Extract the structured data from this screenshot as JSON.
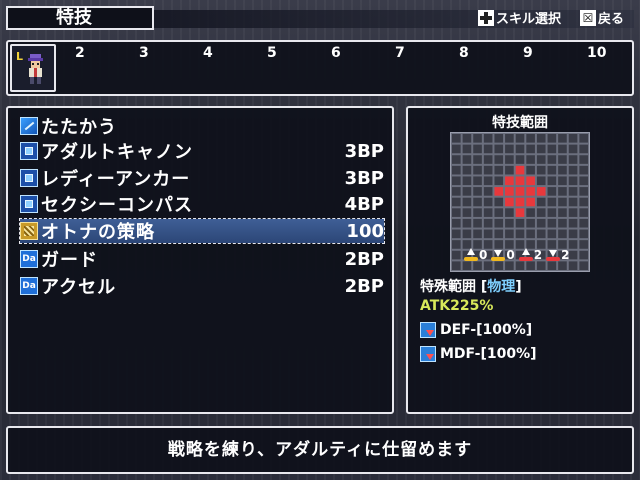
{
  "header": {
    "title": "特技",
    "hint_select_label": "スキル選択",
    "hint_back_label": "戻る",
    "hint_back_button_glyph": "☒"
  },
  "party": {
    "selected_mark": "L",
    "slots": [
      "2",
      "3",
      "4",
      "5",
      "6",
      "7",
      "8",
      "9",
      "10"
    ]
  },
  "skills": [
    {
      "icon": "attack-icon",
      "name": "たたかう",
      "cost": ""
    },
    {
      "icon": "skill-square-icon",
      "name": "アダルトキャノン",
      "cost": "3BP"
    },
    {
      "icon": "skill-square-icon",
      "name": "レディーアンカー",
      "cost": "3BP"
    },
    {
      "icon": "skill-square-icon",
      "name": "セクシーコンパス",
      "cost": "4BP"
    },
    {
      "icon": "gold-skill-icon",
      "name": "オトナの策略",
      "cost": "100",
      "selected": true
    },
    {
      "icon": "da-icon",
      "icon_text": "Da",
      "name": "ガード",
      "cost": "2BP"
    },
    {
      "icon": "da-icon",
      "icon_text": "Da",
      "name": "アクセル",
      "cost": "2BP"
    }
  ],
  "range_panel": {
    "title": "特技範囲",
    "grid_size": 13,
    "highlighted_cells": [
      [
        6,
        3
      ],
      [
        5,
        4
      ],
      [
        6,
        4
      ],
      [
        7,
        4
      ],
      [
        4,
        5
      ],
      [
        5,
        5
      ],
      [
        6,
        5
      ],
      [
        7,
        5
      ],
      [
        8,
        5
      ],
      [
        5,
        6
      ],
      [
        6,
        6
      ],
      [
        7,
        6
      ],
      [
        6,
        7
      ]
    ],
    "cell_color": "#3a3c47",
    "highlight_color": "#e8383c",
    "stats": [
      {
        "icon": "up-yellow-icon",
        "value": "0"
      },
      {
        "icon": "down-yellow-icon",
        "value": "0"
      },
      {
        "icon": "up-red-icon",
        "value": "2"
      },
      {
        "icon": "down-red-icon",
        "value": "2"
      }
    ],
    "special_range_label": "特殊範囲 [",
    "special_range_type": "物理",
    "special_range_close": "]",
    "atk": "ATK225%",
    "def": "DEF-[100%]",
    "mdf": "MDF-[100%]"
  },
  "help_text": "戦略を練り、アダルティに仕留めます"
}
